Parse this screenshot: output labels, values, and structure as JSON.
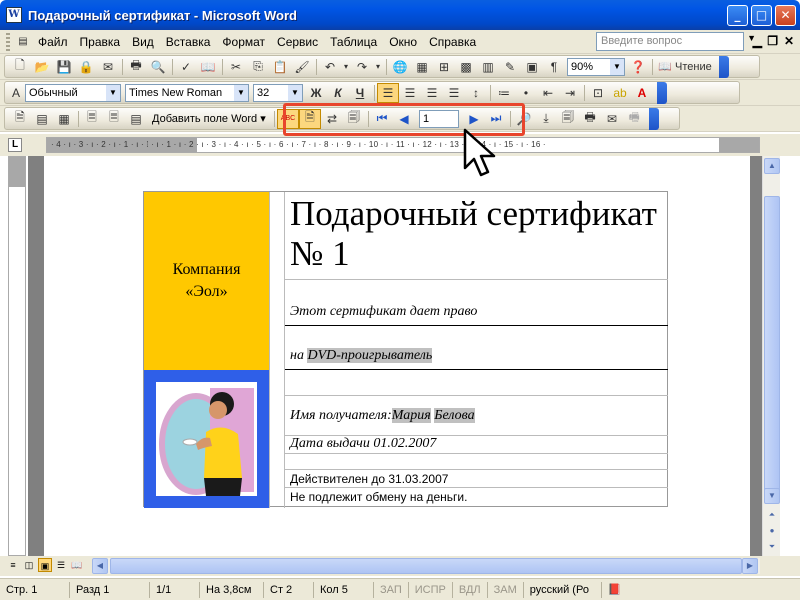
{
  "window": {
    "title": "Подарочный сертификат - Microsoft Word",
    "icon": "W"
  },
  "menu": {
    "items": [
      "Файл",
      "Правка",
      "Вид",
      "Вставка",
      "Формат",
      "Сервис",
      "Таблица",
      "Окно",
      "Справка"
    ],
    "help_placeholder": "Введите вопрос"
  },
  "standard_toolbar": {
    "zoom": "90%",
    "read_label": "Чтение"
  },
  "format_toolbar": {
    "style": "Обычный",
    "font": "Times New Roman",
    "size": "32",
    "bold": "Ж",
    "italic": "К",
    "underline": "Ч"
  },
  "mailmerge_toolbar": {
    "insert_field": "Добавить поле Word",
    "record_number": "1",
    "abc_label": "ABC"
  },
  "ruler": {
    "h_ticks": "· 4 · ı · 3 · ı · 2 · ı · 1 · ı · ⁞ · ı · 1 · ı · 2 · ı · 3 · ı · 4 · ı · 5 · ı · 6 · ı · 7 · ı · 8 · ı · 9 · ı · 10 · ı · 11 · ı · 12 · ı · 13 · ı · 14 · ı · 15 · ı · 16 ·"
  },
  "certificate": {
    "company": "Компания «Эол»",
    "title": "Подарочный сертификат № 1",
    "line1": "Этот сертификат дает право",
    "line2_prefix": "на ",
    "line2_field": "DVD-проигрыватель",
    "recipient_prefix": "Имя получателя:",
    "recipient_first": "Мария",
    "recipient_last": "Белова",
    "issue_date": "Дата выдачи 01.02.2007",
    "valid_until": "Действителен до 31.03.2007",
    "no_exchange": "Не подлежит обмену на деньги."
  },
  "status": {
    "page": "Стр. 1",
    "section": "Разд 1",
    "pages": "1/1",
    "at": "На 3,8см",
    "line": "Ст 2",
    "col": "Кол 5",
    "rec": "ЗАП",
    "trk": "ИСПР",
    "ext": "ВДЛ",
    "ovr": "ЗАМ",
    "lang": "русский (Ро"
  },
  "colors": {
    "company_bg": "#ffc800",
    "photo_bg": "#2f5fe8",
    "highlight": "#e8452c"
  }
}
